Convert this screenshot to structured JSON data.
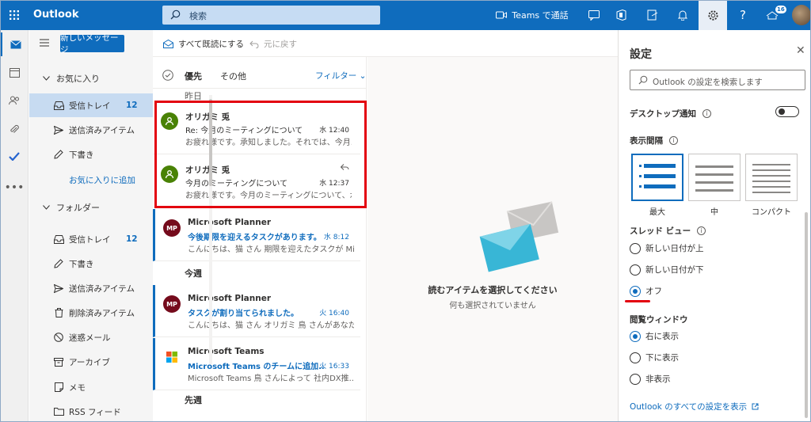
{
  "app": {
    "name": "Outlook"
  },
  "topbar": {
    "search_placeholder": "検索",
    "teams_label": "Teams で通話",
    "notification_count": "16"
  },
  "folders": {
    "new_message": "新しいメッセージ",
    "favorites_header": "お気に入り",
    "favorites": [
      {
        "label": "受信トレイ",
        "count": "12"
      },
      {
        "label": "送信済みアイテム",
        "count": ""
      },
      {
        "label": "下書き",
        "count": ""
      }
    ],
    "add_favorite": "お気に入りに追加",
    "folders_header": "フォルダー",
    "items": [
      {
        "label": "受信トレイ",
        "count": "12"
      },
      {
        "label": "下書き",
        "count": ""
      },
      {
        "label": "送信済みアイテム",
        "count": ""
      },
      {
        "label": "削除済みアイテム",
        "count": ""
      },
      {
        "label": "迷惑メール",
        "count": ""
      },
      {
        "label": "アーカイブ",
        "count": ""
      },
      {
        "label": "メモ",
        "count": ""
      },
      {
        "label": "RSS フィード",
        "count": ""
      }
    ]
  },
  "commands": {
    "mark_all_read": "すべて既読にする",
    "undo": "元に戻す"
  },
  "list": {
    "tab_focused": "優先",
    "tab_other": "その他",
    "filter": "フィルター",
    "groups": {
      "yesterday": "昨日",
      "this_week": "今週",
      "last_week": "先週"
    },
    "messages": [
      {
        "sender": "オリガミ 兎",
        "subject": "Re: 今月のミーティングについて",
        "time": "水 12:40",
        "preview": "お疲れ様です。承知しました。それでは、今月...",
        "avatar": "",
        "unread": false
      },
      {
        "sender": "オリガミ 兎",
        "subject": "今月のミーティングについて",
        "time": "水 12:37",
        "preview": "お疲れ様です。今月のミーティングについて、水...",
        "avatar": "",
        "unread": false
      },
      {
        "sender": "Microsoft Planner",
        "subject": "今後期限を迎えるタスクがあります。",
        "time": "水 8:12",
        "preview": "こんにちは、猫 さん 期限を迎えたタスクが Mic...",
        "avatar": "MP",
        "unread": true
      },
      {
        "sender": "Microsoft Planner",
        "subject": "タスクが割り当てられました。",
        "time": "火 16:40",
        "preview": "こんにちは、猫 さん オリガミ 鳥 さんがあなたに...",
        "avatar": "MP",
        "unread": true
      },
      {
        "sender": "Microsoft Teams",
        "subject": "Microsoft Teams のチームに追加...",
        "time": "火 16:33",
        "preview": "Microsoft Teams 鳥 さんによって 社内DX推...",
        "avatar": "",
        "unread": true
      }
    ]
  },
  "reading": {
    "empty_title": "読むアイテムを選択してください",
    "empty_sub": "何も選択されていません"
  },
  "settings": {
    "title": "設定",
    "search_placeholder": "Outlook の設定を検索します",
    "desktop_notify": "デスクトップ通知",
    "density_label": "表示間隔",
    "density_options": [
      "最大",
      "中",
      "コンパクト"
    ],
    "thread_label": "スレッド ビュー",
    "thread_options": [
      "新しい日付が上",
      "新しい日付が下",
      "オフ"
    ],
    "reading_label": "閲覧ウィンドウ",
    "reading_options": [
      "右に表示",
      "下に表示",
      "非表示"
    ],
    "all_settings_link": "Outlook のすべての設定を表示"
  },
  "colors": {
    "brand": "#0f6cbd",
    "highlight": "#e3000f",
    "avatar_green": "#498205",
    "avatar_planner": "#750b1c"
  }
}
